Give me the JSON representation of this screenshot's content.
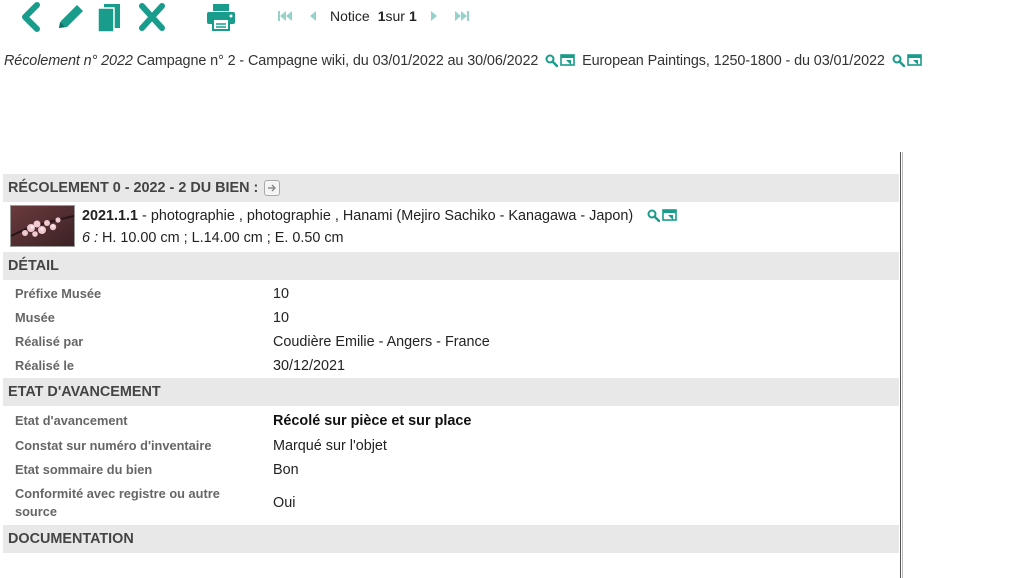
{
  "toolbar": {
    "buttons": [
      {
        "icon": "back-icon"
      },
      {
        "icon": "edit-icon"
      },
      {
        "icon": "duplicate-icon"
      },
      {
        "icon": "delete-icon"
      },
      {
        "icon": "print-icon"
      }
    ],
    "accent_color": "#1a9c8c"
  },
  "pager": {
    "label": "Notice",
    "current": "1",
    "separator": "sur",
    "total": "1"
  },
  "breadcrumb": {
    "recolement": "Récolement n° 2022",
    "campaign": "Campagne n° 2 - Campagne wiki, du 03/01/2022 au 30/06/2022",
    "collection": "European Paintings, 1250-1800 - du 03/01/2022"
  },
  "sections": {
    "header": "RÉCOLEMENT 0 - 2022 - 2 DU BIEN :",
    "detail": "DÉTAIL",
    "progress": "ETAT D'AVANCEMENT",
    "documentation": "DOCUMENTATION"
  },
  "object": {
    "inventory": "2021.1.1",
    "description": " - photographie , photographie , Hanami (Mejiro Sachiko - Kanagawa - Japon)",
    "dims_label": "6 :",
    "dims": " H. 10.00 cm ; L.14.00 cm ; E. 0.50 cm"
  },
  "detail": [
    {
      "label": "Préfixe Musée",
      "value": "10"
    },
    {
      "label": "Musée",
      "value": "10"
    },
    {
      "label": "Réalisé par",
      "value": "Coudière Emilie - Angers - France"
    },
    {
      "label": "Réalisé le",
      "value": "30/12/2021"
    }
  ],
  "progress": [
    {
      "label": "Etat d'avancement",
      "value": "Récolé sur pièce et sur place"
    },
    {
      "label": "Constat sur numéro d'inventaire",
      "value": "Marqué sur l'objet"
    },
    {
      "label": "Etat sommaire du bien",
      "value": "Bon"
    },
    {
      "label": "Conformité avec registre ou autre source",
      "value": "Oui"
    }
  ]
}
